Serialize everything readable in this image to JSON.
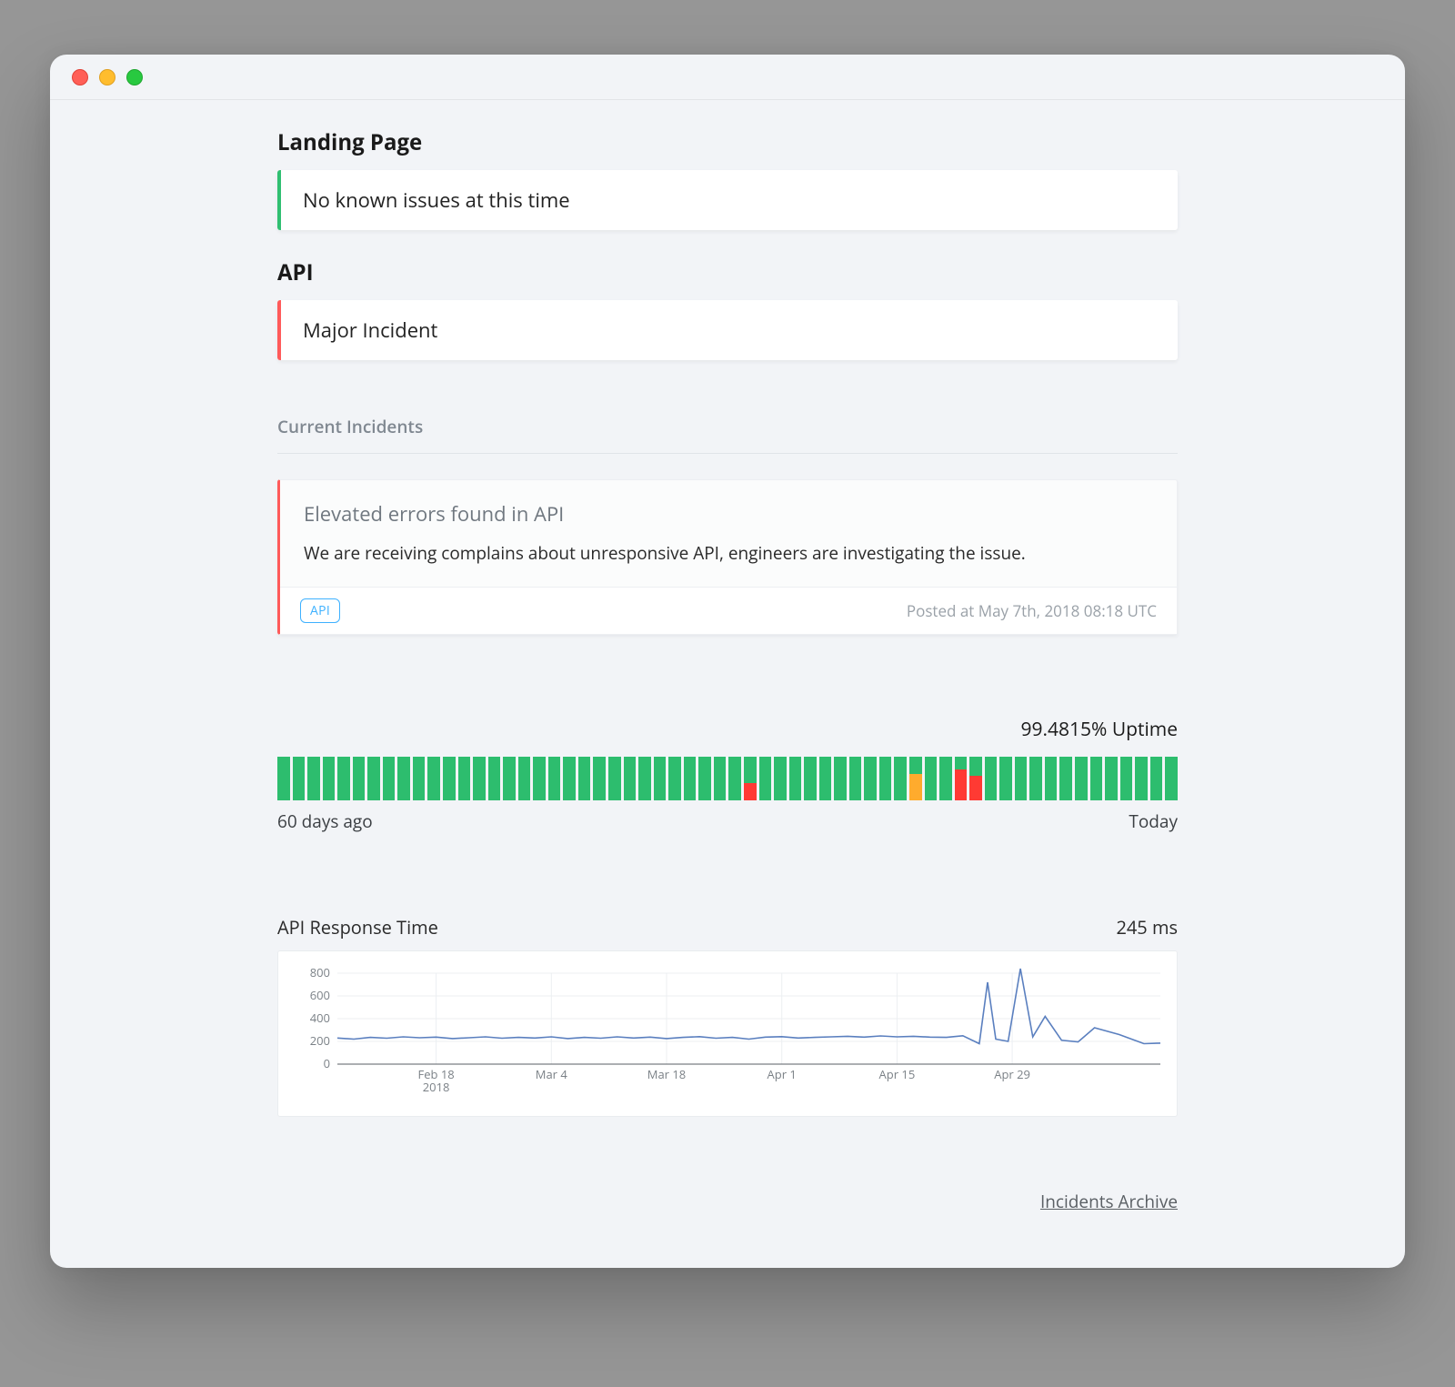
{
  "services": [
    {
      "name": "Landing Page",
      "status_text": "No known issues at this time",
      "status": "ok"
    },
    {
      "name": "API",
      "status_text": "Major Incident",
      "status": "bad"
    }
  ],
  "current_incidents_heading": "Current Incidents",
  "incident": {
    "title": "Elevated errors found in API",
    "description": "We are receiving complains about unresponsive API, engineers are investigating the issue.",
    "tag": "API",
    "posted": "Posted at May 7th, 2018 08:18 UTC"
  },
  "uptime": {
    "percent_label": "99.4815% Uptime",
    "left_label": "60 days ago",
    "right_label": "Today",
    "bars": [
      {
        "s": "g"
      },
      {
        "s": "g"
      },
      {
        "s": "g"
      },
      {
        "s": "g"
      },
      {
        "s": "g"
      },
      {
        "s": "g"
      },
      {
        "s": "g"
      },
      {
        "s": "g"
      },
      {
        "s": "g"
      },
      {
        "s": "g"
      },
      {
        "s": "g"
      },
      {
        "s": "g"
      },
      {
        "s": "g"
      },
      {
        "s": "g"
      },
      {
        "s": "g"
      },
      {
        "s": "g"
      },
      {
        "s": "g"
      },
      {
        "s": "g"
      },
      {
        "s": "g"
      },
      {
        "s": "g"
      },
      {
        "s": "g"
      },
      {
        "s": "g"
      },
      {
        "s": "g"
      },
      {
        "s": "g"
      },
      {
        "s": "g"
      },
      {
        "s": "g"
      },
      {
        "s": "g"
      },
      {
        "s": "g"
      },
      {
        "s": "g"
      },
      {
        "s": "g"
      },
      {
        "s": "g"
      },
      {
        "s": "r",
        "p": 38
      },
      {
        "s": "g"
      },
      {
        "s": "g"
      },
      {
        "s": "g"
      },
      {
        "s": "g"
      },
      {
        "s": "g"
      },
      {
        "s": "g"
      },
      {
        "s": "g"
      },
      {
        "s": "g"
      },
      {
        "s": "g"
      },
      {
        "s": "g"
      },
      {
        "s": "y",
        "p": 60
      },
      {
        "s": "g"
      },
      {
        "s": "g"
      },
      {
        "s": "r",
        "p": 70
      },
      {
        "s": "r",
        "p": 55
      },
      {
        "s": "g"
      },
      {
        "s": "g"
      },
      {
        "s": "g"
      },
      {
        "s": "g"
      },
      {
        "s": "g"
      },
      {
        "s": "g"
      },
      {
        "s": "g"
      },
      {
        "s": "g"
      },
      {
        "s": "g"
      },
      {
        "s": "g"
      },
      {
        "s": "g"
      },
      {
        "s": "g"
      },
      {
        "s": "g"
      }
    ]
  },
  "response_time": {
    "title": "API Response Time",
    "value_label": "245 ms"
  },
  "archive_link": "Incidents Archive",
  "chart_data": {
    "type": "line",
    "title": "API Response Time",
    "xlabel": "",
    "ylabel": "",
    "ylim": [
      0,
      800
    ],
    "y_ticks": [
      0,
      200,
      400,
      600,
      800
    ],
    "x_tick_labels": [
      "Feb 18 2018",
      "Mar 4",
      "Mar 18",
      "Apr 1",
      "Apr 15",
      "Apr 29"
    ],
    "x_tick_positions": [
      0.12,
      0.26,
      0.4,
      0.54,
      0.68,
      0.82
    ],
    "series": [
      {
        "name": "API Response Time (ms)",
        "points": [
          [
            0.0,
            230
          ],
          [
            0.02,
            220
          ],
          [
            0.04,
            235
          ],
          [
            0.06,
            228
          ],
          [
            0.08,
            240
          ],
          [
            0.1,
            232
          ],
          [
            0.12,
            238
          ],
          [
            0.14,
            225
          ],
          [
            0.16,
            232
          ],
          [
            0.18,
            240
          ],
          [
            0.2,
            228
          ],
          [
            0.22,
            235
          ],
          [
            0.24,
            230
          ],
          [
            0.26,
            240
          ],
          [
            0.28,
            225
          ],
          [
            0.3,
            235
          ],
          [
            0.32,
            228
          ],
          [
            0.34,
            240
          ],
          [
            0.36,
            230
          ],
          [
            0.38,
            238
          ],
          [
            0.4,
            225
          ],
          [
            0.42,
            235
          ],
          [
            0.44,
            242
          ],
          [
            0.46,
            228
          ],
          [
            0.48,
            235
          ],
          [
            0.5,
            220
          ],
          [
            0.52,
            238
          ],
          [
            0.54,
            242
          ],
          [
            0.56,
            230
          ],
          [
            0.58,
            235
          ],
          [
            0.6,
            240
          ],
          [
            0.62,
            245
          ],
          [
            0.64,
            238
          ],
          [
            0.66,
            248
          ],
          [
            0.68,
            240
          ],
          [
            0.7,
            245
          ],
          [
            0.72,
            238
          ],
          [
            0.74,
            235
          ],
          [
            0.76,
            250
          ],
          [
            0.78,
            180
          ],
          [
            0.79,
            720
          ],
          [
            0.8,
            220
          ],
          [
            0.815,
            200
          ],
          [
            0.83,
            840
          ],
          [
            0.845,
            240
          ],
          [
            0.86,
            420
          ],
          [
            0.88,
            210
          ],
          [
            0.9,
            195
          ],
          [
            0.92,
            320
          ],
          [
            0.95,
            260
          ],
          [
            0.98,
            180
          ],
          [
            1.0,
            185
          ]
        ]
      }
    ]
  }
}
